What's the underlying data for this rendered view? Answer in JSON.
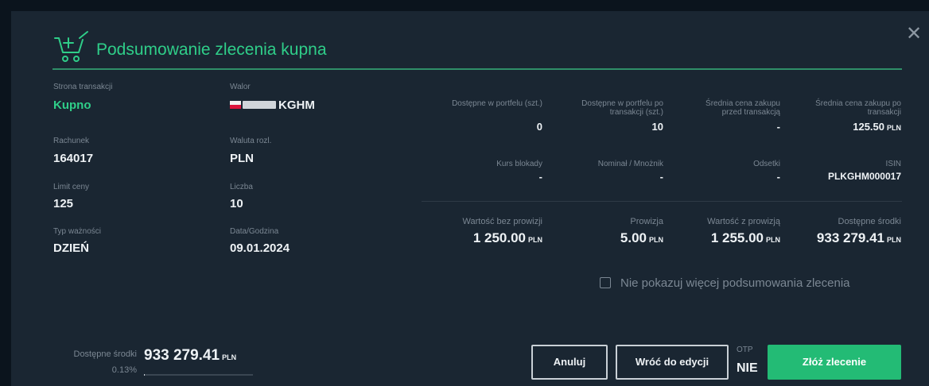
{
  "title": "Podsumowanie zlecenia kupna",
  "left": {
    "side": {
      "label": "Strona transakcji",
      "value": "Kupno"
    },
    "security": {
      "label": "Walor",
      "chip": "KGHM",
      "value": "KGHM"
    },
    "account": {
      "label": "Rachunek",
      "value": "164017"
    },
    "currency": {
      "label": "Waluta rozl.",
      "value": "PLN"
    },
    "price_limit": {
      "label": "Limit ceny",
      "value": "125"
    },
    "quantity": {
      "label": "Liczba",
      "value": "10"
    },
    "validity": {
      "label": "Typ ważności",
      "value": "DZIEŃ"
    },
    "datetime": {
      "label": "Data/Godzina",
      "value": "09.01.2024"
    }
  },
  "stats_row1": [
    {
      "label": "Dostępne w portfelu (szt.)",
      "value": "0"
    },
    {
      "label": "Dostępne w portfelu po transakcji (szt.)",
      "value": "10"
    },
    {
      "label": "Średnia cena zakupu przed transakcją",
      "value": "-"
    },
    {
      "label": "Średnia cena zakupu po transakcji",
      "value": "125.50",
      "unit": "PLN"
    }
  ],
  "stats_row2": [
    {
      "label": "Kurs blokady",
      "value": "-"
    },
    {
      "label": "Nominał / Mnożnik",
      "value": "-"
    },
    {
      "label": "Odsetki",
      "value": "-"
    },
    {
      "label": "ISIN",
      "value": "PLKGHM000017"
    }
  ],
  "totals": [
    {
      "label": "Wartość bez prowizji",
      "value": "1 250.00",
      "unit": "PLN"
    },
    {
      "label": "Prowizja",
      "value": "5.00",
      "unit": "PLN"
    },
    {
      "label": "Wartość z prowizją",
      "value": "1 255.00",
      "unit": "PLN"
    },
    {
      "label": "Dostępne środki",
      "value": "933 279.41",
      "unit": "PLN"
    }
  ],
  "checkbox": {
    "label": "Nie pokazuj więcej podsumowania zlecenia",
    "checked": false
  },
  "footer": {
    "funds_label": "Dostępne środki",
    "funds_value": "933 279.41",
    "funds_unit": "PLN",
    "usage_percent_label": "0.13%",
    "usage_fraction": 0.0013,
    "otp_label": "OTP",
    "otp_value": "NIE",
    "cancel_label": "Anuluj",
    "back_label": "Wróć do edycji",
    "submit_label": "Złóż zlecenie"
  },
  "colors": {
    "accent": "#2fce89",
    "primary_button": "#23bb75",
    "background": "#1a2632"
  }
}
